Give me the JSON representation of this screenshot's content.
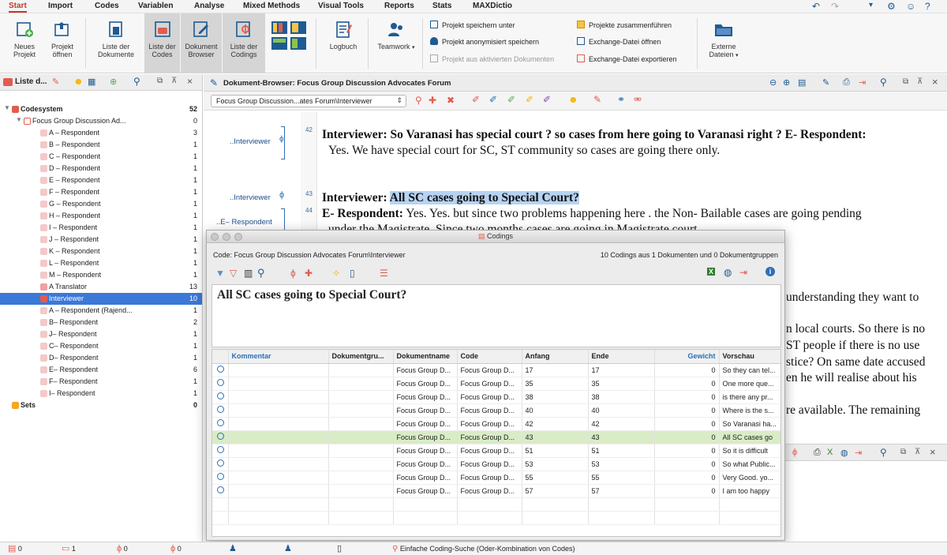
{
  "menu": [
    "Start",
    "Import",
    "Codes",
    "Variablen",
    "Analyse",
    "Mixed Methods",
    "Visual Tools",
    "Reports",
    "Stats",
    "MAXDictio"
  ],
  "ribbon": {
    "neues_projekt": "Neues Projekt",
    "projekt_oeffnen": "Projekt öffnen",
    "liste_dokumente": "Liste der Dokumente",
    "liste_codes": "Liste der Codes",
    "dokument_browser": "Dokument Browser",
    "liste_codings": "Liste der Codings",
    "logbuch": "Logbuch",
    "teamwork": "Teamwork",
    "speichern_unter": "Projekt speichern unter",
    "anonymisiert": "Projekt anonymisiert speichern",
    "aus_aktiven": "Projekt aus aktivierten Dokumenten",
    "zusammenfuehren": "Projekte zusammenführen",
    "exchange_oeffnen": "Exchange-Datei öffnen",
    "exchange_exportieren": "Exchange-Datei exportieren",
    "externe_dateien": "Externe Dateien"
  },
  "left_panel": {
    "title": "Liste d...",
    "tree": [
      {
        "label": "Codesystem",
        "count": "52",
        "bold": true
      },
      {
        "label": "Focus Group Discussion Ad...",
        "count": "0"
      },
      {
        "label": "A – Respondent",
        "count": "3",
        "color": "#f3c9c9"
      },
      {
        "label": "B – Respondent",
        "count": "1",
        "color": "#f3c9c9"
      },
      {
        "label": "C – Respondent",
        "count": "1",
        "color": "#f3c9c9"
      },
      {
        "label": "D – Respondent",
        "count": "1",
        "color": "#f3c9c9"
      },
      {
        "label": "E – Respondent",
        "count": "1",
        "color": "#f3c9c9"
      },
      {
        "label": "F – Respondent",
        "count": "1",
        "color": "#f3c9c9"
      },
      {
        "label": "G – Respondent",
        "count": "1",
        "color": "#f3c9c9"
      },
      {
        "label": "H – Respondent",
        "count": "1",
        "color": "#f3c9c9"
      },
      {
        "label": "I – Respondent",
        "count": "1",
        "color": "#f3c9c9"
      },
      {
        "label": "J – Respondent",
        "count": "1",
        "color": "#f3c9c9"
      },
      {
        "label": "K – Respondent",
        "count": "1",
        "color": "#f3c9c9"
      },
      {
        "label": "L – Respondent",
        "count": "1",
        "color": "#f3c9c9"
      },
      {
        "label": "M – Respondent",
        "count": "1",
        "color": "#f3c9c9"
      },
      {
        "label": "A Translator",
        "count": "13",
        "color": "#f0a0a0"
      },
      {
        "label": "Interviewer",
        "count": "10",
        "color": "#e35b4e",
        "selected": true
      },
      {
        "label": "A – Respondent (Rajend...",
        "count": "1",
        "color": "#f3c9c9"
      },
      {
        "label": "B– Respondent",
        "count": "2",
        "color": "#f3c9c9"
      },
      {
        "label": "J– Respondent",
        "count": "1",
        "color": "#f3c9c9"
      },
      {
        "label": "C– Respondent",
        "count": "1",
        "color": "#f3c9c9"
      },
      {
        "label": "D– Respondent",
        "count": "1",
        "color": "#f3c9c9"
      },
      {
        "label": "E– Respondent",
        "count": "6",
        "color": "#f3c9c9"
      },
      {
        "label": "F– Respondent",
        "count": "1",
        "color": "#f3c9c9"
      },
      {
        "label": "I– Respondent",
        "count": "1",
        "color": "#f3c9c9"
      },
      {
        "label": "Sets",
        "count": "0",
        "bold": true
      }
    ]
  },
  "doc_browser": {
    "title": "Dokument-Browser: Focus Group Discussion Advocates Forum",
    "select_value": "Focus Group Discussion...ates Forum\\Interviewer",
    "code_labels": [
      "..Interviewer",
      "..Interviewer",
      "..E– Respondent"
    ],
    "para_numbers": [
      "42",
      "43",
      "44"
    ],
    "p42_bold": "Interviewer: So Varanasi has special court ? so cases from here going to Varanasi right ? E- Respondent:",
    "p42_rest": "Yes. We have special court for SC, ST community so cases are going there only.",
    "p43_bold": "Interviewer: ",
    "p43_hl": "All SC cases going to Special Court?",
    "p44_bold": "E- Respondent:",
    "p44_text": " Yes. Yes. but since two problems happening here . the Non- Bailable cases are going pending",
    "p44_cut": "under the Magistrate. Since two months cases are going in Magistrate court.",
    "right_frag1": "understanding they want to",
    "right_frag2": "n local courts. So there is no",
    "right_frag3": "ST people if there is no use",
    "right_frag4": "stice? On same date accused",
    "right_frag5": "en he will realise about his",
    "right_frag6": "re available. The remaining"
  },
  "codings": {
    "window_title": "Codings",
    "code_path": "Code: Focus Group Discussion Advocates Forum\\Interviewer",
    "summary": "10 Codings aus 1 Dokumenten und 0 Dokumentgruppen",
    "preview": "All SC cases going to Special Court?",
    "columns": [
      "Kommentar",
      "Dokumentgru...",
      "Dokumentname",
      "Code",
      "Anfang",
      "Ende",
      "Gewicht",
      "Vorschau"
    ],
    "rows": [
      {
        "doc": "Focus Group D...",
        "code": "Focus Group D...",
        "start": "17",
        "end": "17",
        "weight": "0",
        "preview": "So they can tel..."
      },
      {
        "doc": "Focus Group D...",
        "code": "Focus Group D...",
        "start": "35",
        "end": "35",
        "weight": "0",
        "preview": "One more que..."
      },
      {
        "doc": "Focus Group D...",
        "code": "Focus Group D...",
        "start": "38",
        "end": "38",
        "weight": "0",
        "preview": "is there any pr..."
      },
      {
        "doc": "Focus Group D...",
        "code": "Focus Group D...",
        "start": "40",
        "end": "40",
        "weight": "0",
        "preview": "Where is the s..."
      },
      {
        "doc": "Focus Group D...",
        "code": "Focus Group D...",
        "start": "42",
        "end": "42",
        "weight": "0",
        "preview": "So Varanasi ha..."
      },
      {
        "doc": "Focus Group D...",
        "code": "Focus Group D...",
        "start": "43",
        "end": "43",
        "weight": "0",
        "preview": "All SC cases go",
        "selected": true
      },
      {
        "doc": "Focus Group D...",
        "code": "Focus Group D...",
        "start": "51",
        "end": "51",
        "weight": "0",
        "preview": "So it is difficult"
      },
      {
        "doc": "Focus Group D...",
        "code": "Focus Group D...",
        "start": "53",
        "end": "53",
        "weight": "0",
        "preview": "So what Public..."
      },
      {
        "doc": "Focus Group D...",
        "code": "Focus Group D...",
        "start": "55",
        "end": "55",
        "weight": "0",
        "preview": "Very Good. yo..."
      },
      {
        "doc": "Focus Group D...",
        "code": "Focus Group D...",
        "start": "57",
        "end": "57",
        "weight": "0",
        "preview": "I am too happy"
      }
    ]
  },
  "statusbar": {
    "docs": "0",
    "codes": "1",
    "a": "0",
    "b": "0",
    "search": "Einfache Coding-Suche (Oder-Kombination von Codes)"
  },
  "colors": {
    "accent": "#c0392b",
    "selection": "#3b78d8",
    "highlight": "#b6d3f2",
    "selected_row": "#d9ecc6"
  }
}
